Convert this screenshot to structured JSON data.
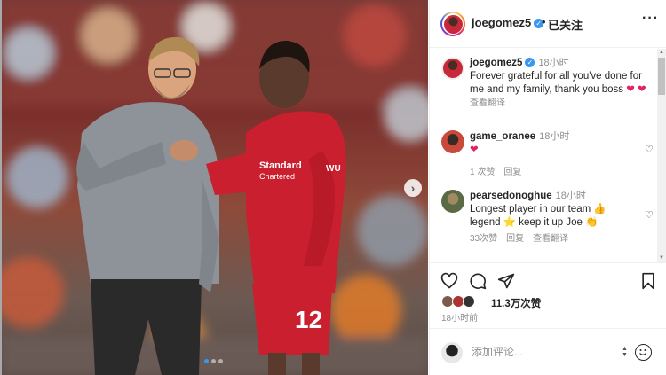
{
  "post": {
    "username": "joegomez5",
    "follow_state": "已关注",
    "separator": "•"
  },
  "caption": {
    "username": "joegomez5",
    "time": "18小时",
    "text": "Forever grateful for all you've done for me and my family, thank you boss",
    "text_emoji": "❤ ❤",
    "translate": "查看翻译"
  },
  "comments": [
    {
      "username": "game_oranee",
      "time": "18小时",
      "text": "❤",
      "likes": "1 次赞",
      "reply": "回复",
      "translate": ""
    },
    {
      "username": "pearsedonoghue",
      "time": "18小时",
      "text_line1": "Longest player in our team",
      "emoji1": "👍",
      "text_line2_a": "legend",
      "emoji2": "⭐",
      "text_line2_b": "keep it up Joe",
      "emoji3": "👏",
      "likes": "33次赞",
      "reply": "回复",
      "translate": "查看翻译"
    }
  ],
  "engagement": {
    "likes_count": "11.3万次赞",
    "posted": "18小时前"
  },
  "comment_input": {
    "placeholder": "添加评论..."
  },
  "carousel": {
    "total": 3,
    "active": 1
  },
  "icons": {
    "next": "chevron-right-icon",
    "more": "more-horizontal-icon",
    "like": "heart-icon",
    "comment": "comment-icon",
    "share": "paper-plane-icon",
    "save": "bookmark-icon",
    "emoji": "smiley-icon"
  },
  "colors": {
    "verified": "#3897f0",
    "heart": "#e0245e",
    "muted": "#8e8e8e"
  }
}
